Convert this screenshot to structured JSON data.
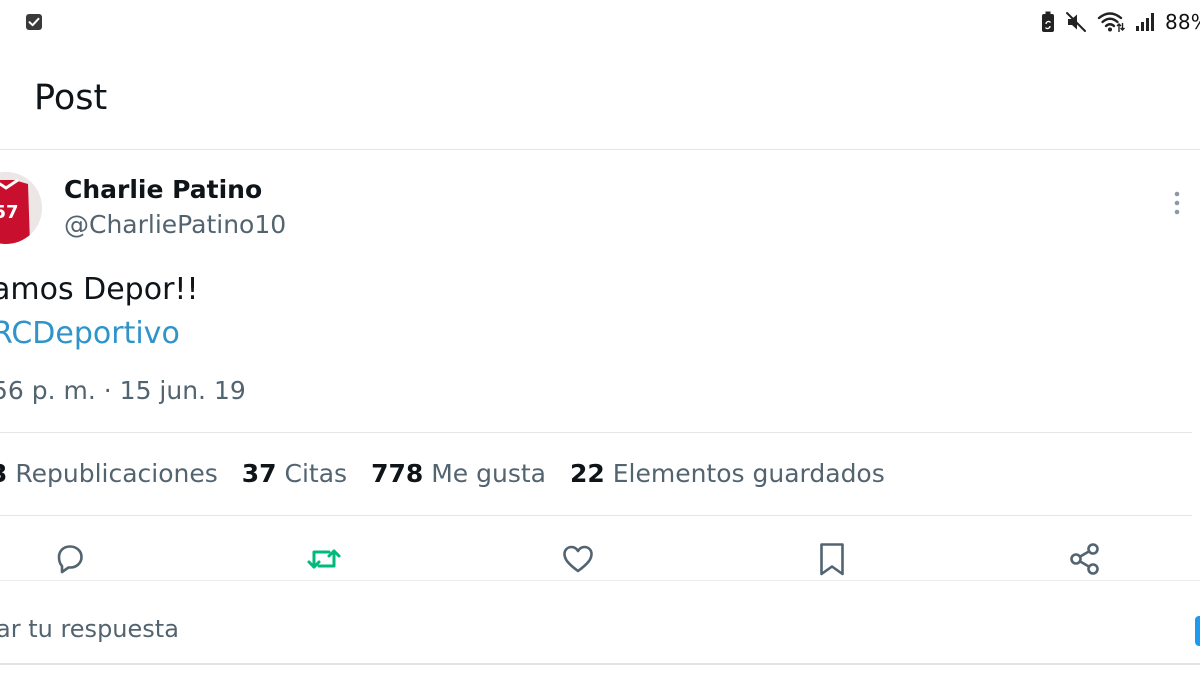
{
  "status_bar": {
    "battery_percent": "88%",
    "icons": [
      "checkbox-notification-icon",
      "battery-saver-icon",
      "mute-icon",
      "wifi-icon",
      "signal-icon"
    ]
  },
  "header": {
    "title": "Post"
  },
  "author": {
    "name": "Charlie Patino",
    "handle": "@CharliePatino10"
  },
  "tweet": {
    "text": "amos Depor!!",
    "hashtag": "RCDeportivo",
    "meta": "56 p. m. · 15 jun. 19"
  },
  "stats": [
    {
      "value": "3",
      "label": "Republicaciones"
    },
    {
      "value": "37",
      "label": "Citas"
    },
    {
      "value": "778",
      "label": "Me gusta"
    },
    {
      "value": "22",
      "label": "Elementos guardados"
    }
  ],
  "actions": {
    "reply": "reply-icon",
    "retweet": "retweet-icon",
    "like": "like-icon",
    "bookmark": "bookmark-icon",
    "share": "share-icon"
  },
  "reply_box": {
    "placeholder": "ar tu respuesta"
  },
  "colors": {
    "text": "#0f1419",
    "secondary": "#536471",
    "hashtag": "#2e94c9",
    "retweet_active": "#00ba7c",
    "accent": "#1d9bf0"
  }
}
